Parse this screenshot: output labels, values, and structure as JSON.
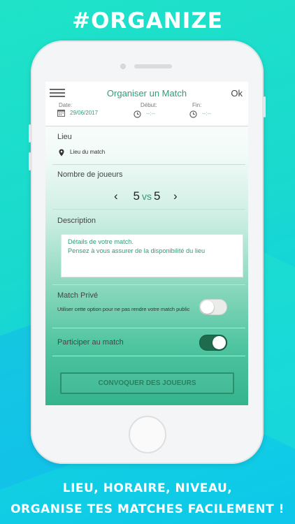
{
  "promo": {
    "title": "#ORGANIZE",
    "caption_line1": "LIEU, HORAIRE, NIVEAU,",
    "caption_line2": "ORGANISE TES MATCHES FACILEMENT !"
  },
  "header": {
    "title": "Organiser un Match",
    "ok_label": "Ok"
  },
  "date_row": {
    "date_label_cut": "Date:",
    "date_value": "29/06/2017",
    "start_label_cut": "Début:",
    "start_value": "--:--",
    "end_label_cut": "Fin:",
    "end_value": "--:--"
  },
  "lieu": {
    "label": "Lieu",
    "placeholder": "Lieu du match"
  },
  "players": {
    "label": "Nombre de joueurs",
    "left_count": "5",
    "vs": "vs",
    "right_count": "5"
  },
  "description": {
    "label": "Description",
    "placeholder": "Détails de votre match.\nPensez à vous assurer de la disponibilité du lieu"
  },
  "private_match": {
    "label": "Match Privé",
    "help": "Utiliser cette option pour ne pas rendre votre match public",
    "enabled": false
  },
  "participate": {
    "label": "Participer au match",
    "enabled": true
  },
  "actions": {
    "convoke_label": "CONVOQUER DES JOUEURS"
  },
  "colors": {
    "accent": "#2f9d74",
    "toggle_on": "#1f6b4d",
    "background": "#19d9cf"
  }
}
